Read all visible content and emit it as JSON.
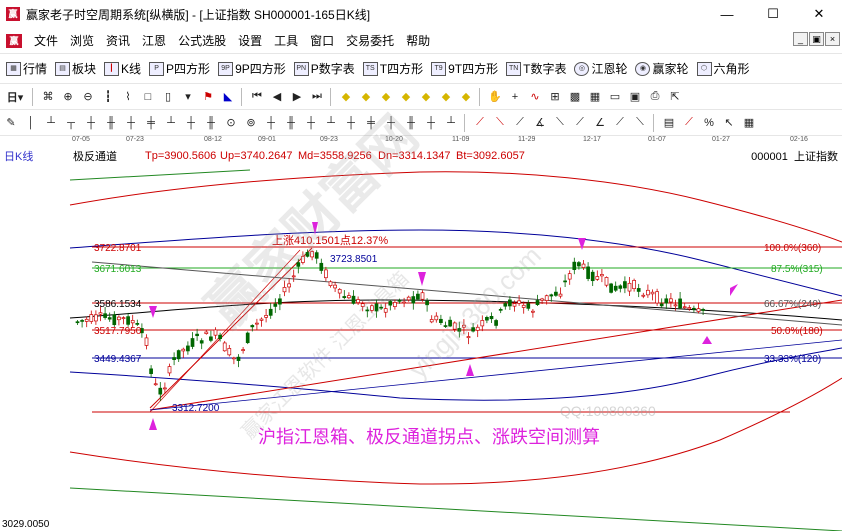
{
  "window": {
    "title": "赢家老子时空周期系统[纵横版] - [上证指数  SH000001-165日K线]",
    "minimize": "—",
    "maximize": "☐",
    "close": "✕"
  },
  "menu": {
    "logo": "赢",
    "items": [
      "文件",
      "浏览",
      "资讯",
      "江恩",
      "公式选股",
      "设置",
      "工具",
      "窗口",
      "交易委托",
      "帮助"
    ]
  },
  "toolbar1": {
    "items": [
      {
        "icon": "grid-icon",
        "label": "行情"
      },
      {
        "icon": "blocks-icon",
        "label": "板块"
      },
      {
        "icon": "kline-icon",
        "label": "K线"
      },
      {
        "icon": "P-icon",
        "label": "P四方形"
      },
      {
        "icon": "9P-icon",
        "label": "9P四方形"
      },
      {
        "icon": "PN-icon",
        "label": "P数字表"
      },
      {
        "icon": "T-icon",
        "label": "T四方形"
      },
      {
        "icon": "9T-icon",
        "label": "9T四方形"
      },
      {
        "icon": "TN-icon",
        "label": "T数字表"
      },
      {
        "icon": "gann-wheel-icon",
        "label": "江恩轮"
      },
      {
        "icon": "winner-wheel-icon",
        "label": "赢家轮"
      },
      {
        "icon": "hexagon-icon",
        "label": "六角形"
      }
    ]
  },
  "infoline": {
    "kline": "日K线",
    "indicator": "极反通道",
    "tp": "Tp=3900.5606",
    "up": "Up=3740.2647",
    "md": "Md=3558.9256",
    "dn": "Dn=3314.1347",
    "bt": "Bt=3092.6057",
    "code": "000001",
    "name": "上证指数"
  },
  "dates": [
    "07-05",
    "07-23",
    "08-12",
    "09-01",
    "09-23",
    "10-20",
    "11-09",
    "11-29",
    "12-17",
    "01-07",
    "01-27",
    "02-16"
  ],
  "chart_labels": {
    "level_3722": "3722.8701",
    "level_3671": "3671.6013",
    "level_3586": "3586.1534",
    "level_3517": "3517.7950",
    "level_3449": "3449.4367",
    "low_3312": "3312.7200",
    "high_3723": "3723.8501",
    "rise_note": "上涨410.1501点12.37%",
    "pct_100": "100.0%(360)",
    "pct_87": "87.5%(315)",
    "pct_66": "66.67%(240)",
    "pct_50": "50.0%(180)",
    "pct_33": "33.33%(120)",
    "bottom_value": "3029.0050",
    "caption": "沪指江恩箱、极反通道拐点、涨跌空间测算",
    "watermark_qq": "QQ:100800360",
    "watermark_site": "yingjia360.com",
    "watermark_brand": "赢家财富网",
    "watermark_soft": "赢家江恩软件 江恩工具箱"
  },
  "colors": {
    "red": "#cc0000",
    "green": "#22aa22",
    "blue": "#000099",
    "magenta": "#dd22dd",
    "candle_up": "#cc0000",
    "candle_down": "#006600"
  }
}
